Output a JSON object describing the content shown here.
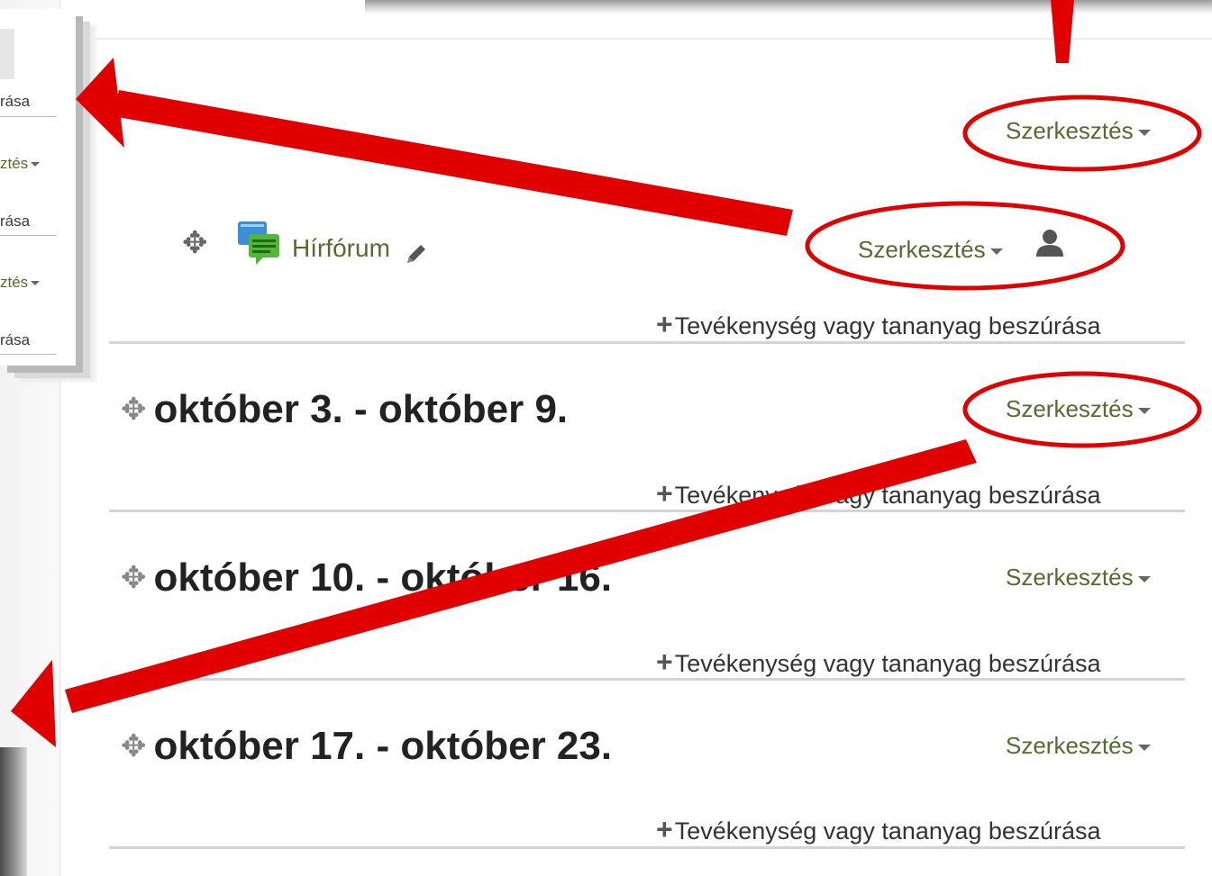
{
  "inset": {
    "items": [
      {
        "type": "text",
        "label": "rása"
      },
      {
        "type": "link",
        "label": "ztés"
      },
      {
        "type": "text",
        "label": "rása"
      },
      {
        "type": "link",
        "label": "ztés"
      },
      {
        "type": "text",
        "label": "rása"
      }
    ]
  },
  "header": {
    "edit_label": "Szerkesztés"
  },
  "forum": {
    "label": "Hírfórum",
    "edit_label": "Szerkesztés",
    "add_label": "Tevékenység vagy tananyag beszúrása"
  },
  "sections": [
    {
      "title": "október 3. - október 9.",
      "edit_label": "Szerkesztés",
      "add_label": "Tevékenység vagy tananyag beszúrása"
    },
    {
      "title": "október 10. - október 16.",
      "edit_label": "Szerkesztés",
      "add_label": "Tevékenység vagy tananyag beszúrása"
    },
    {
      "title": "október 17. - október 23.",
      "edit_label": "Szerkesztés",
      "add_label": "Tevékenység vagy tananyag beszúrása"
    }
  ],
  "icons": {
    "move": "move-icon",
    "forum": "forum-icon",
    "edit": "pencil-icon",
    "user": "user-icon",
    "add": "plus-icon",
    "dropdown": "caret-down-icon"
  },
  "colors": {
    "link": "#556b2f",
    "annotation": "#e00000",
    "title": "#222222"
  }
}
